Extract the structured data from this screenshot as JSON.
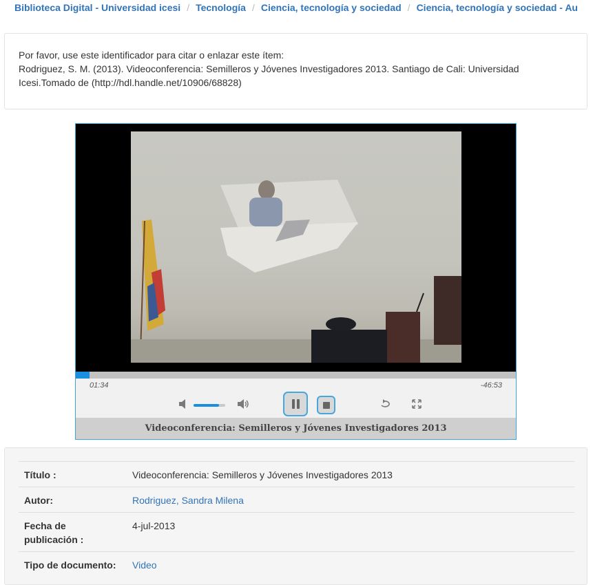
{
  "breadcrumb": [
    "Biblioteca Digital - Universidad icesi",
    "Tecnología",
    "Ciencia, tecnología y sociedad",
    "Ciencia, tecnología y sociedad - Au"
  ],
  "citation": {
    "intro": "Por favor, use este identificador para citar o enlazar este ítem:",
    "text": "Rodriguez, S. M. (2013). Videoconferencia: Semilleros y Jóvenes Investigadores 2013. Santiago de Cali: Universidad Icesi.Tomado de (http://hdl.handle.net/10906/68828)"
  },
  "player": {
    "elapsed": "01:34",
    "remaining": "-46:53",
    "progress_fraction": 0.032,
    "volume_fraction": 0.8,
    "caption": "Videoconferencia: Semilleros y Jóvenes Investigadores 2013",
    "icons": {
      "mute": "volume-low-icon",
      "volume_up": "volume-high-icon",
      "pause": "pause-icon",
      "stop": "stop-icon",
      "loop": "loop-icon",
      "fullscreen": "fullscreen-icon"
    },
    "accent_color": "#1a8fe0"
  },
  "metadata": [
    {
      "label": "Título :",
      "value": "Videoconferencia: Semilleros y Jóvenes Investigadores 2013",
      "link": false
    },
    {
      "label": "Autor:",
      "value": "Rodriguez, Sandra Milena",
      "link": true
    },
    {
      "label": "Fecha de publicación :",
      "value": "4-jul-2013",
      "link": false
    },
    {
      "label": "Tipo de documento:",
      "value": "Video",
      "link": true
    }
  ],
  "colors": {
    "link": "#3174b8",
    "panel_bg": "#f5f5f5",
    "player_border": "#3fa5d8"
  }
}
